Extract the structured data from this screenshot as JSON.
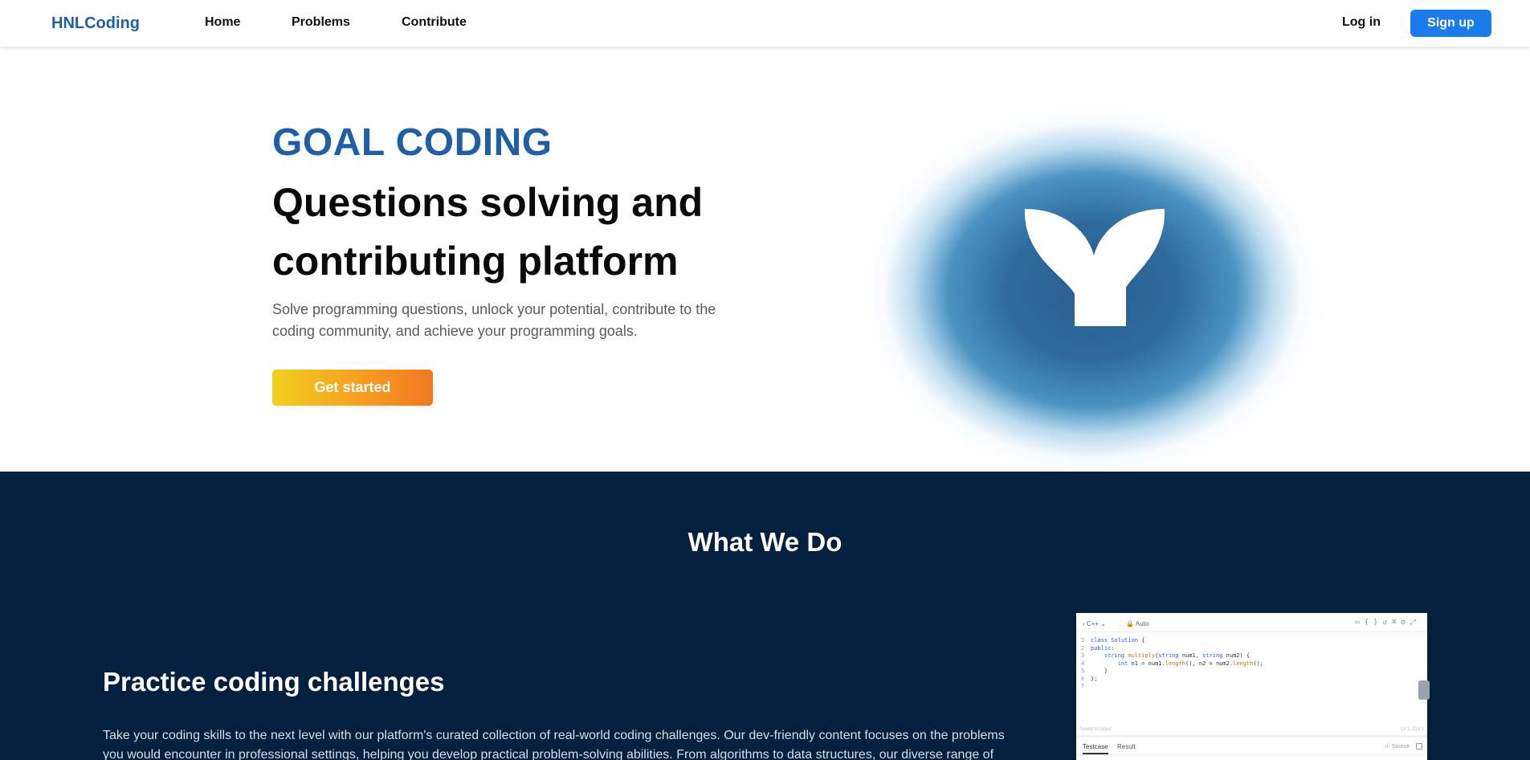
{
  "navbar": {
    "brand": "HNLCoding",
    "links": [
      "Home",
      "Problems",
      "Contribute"
    ],
    "login": "Log in",
    "signup": "Sign up"
  },
  "hero": {
    "eyebrow": "GOAL CODING",
    "headline": "Questions solving and contributing platform",
    "subtext": "Solve programming questions, unlock your potential, contribute to the coding community, and achieve your programming goals.",
    "cta": "Get started"
  },
  "what_we_do": {
    "title": "What We Do",
    "practice_title": "Practice coding challenges",
    "practice_text": "Take your coding skills to the next level with our platform's curated collection of real-world coding challenges. Our dev-friendly content focuses on the problems you would encounter in professional settings, helping you develop practical problem-solving abilities. From algorithms to data structures, our diverse range of"
  },
  "editor": {
    "language": "C++",
    "mode": "Auto",
    "line_numbers": [
      "1",
      "2",
      "3",
      "4",
      "5",
      "6",
      "7"
    ],
    "status_left": "Saved to cloud",
    "status_right": "Ln 1, Col 1",
    "tab_testcase": "Testcase",
    "tab_result": "Result",
    "source": "Source"
  },
  "colors": {
    "brand_blue": "#1f5fa8",
    "signup_blue": "#1a7bea",
    "dark_navy": "#03203f",
    "cta_gradient_start": "#f4cf1e",
    "cta_gradient_end": "#f3791f"
  }
}
